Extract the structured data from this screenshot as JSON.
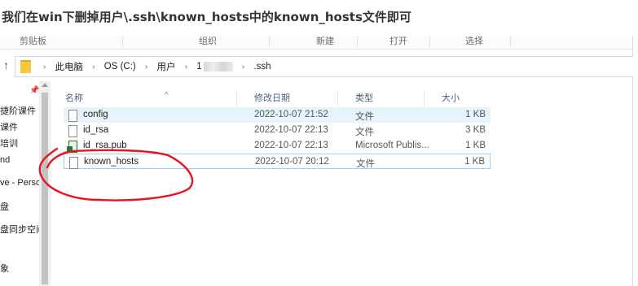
{
  "heading": "我们在win下删掉用户\\.ssh\\known_hosts中的known_hosts文件即可",
  "ribbon": {
    "groups": [
      "剪贴板",
      "组织",
      "新建",
      "打开",
      "选择"
    ]
  },
  "address": {
    "crumbs": [
      "此电脑",
      "OS (C:)",
      "用户",
      "1",
      ".ssh"
    ]
  },
  "nav_pane": {
    "items": [
      "捷阶课件",
      "课件",
      "培训",
      "nd",
      "ve - Perso",
      "盘",
      "盘同步空间",
      "象"
    ]
  },
  "columns": {
    "name": "名称",
    "date": "修改日期",
    "type": "类型",
    "size": "大小"
  },
  "files": [
    {
      "name": "config",
      "date": "2022-10-07 21:52",
      "type": "文件",
      "size": "1 KB"
    },
    {
      "name": "id_rsa",
      "date": "2022-10-07 22:13",
      "type": "文件",
      "size": "3 KB"
    },
    {
      "name": "id_rsa.pub",
      "date": "2022-10-07 22:13",
      "type": "Microsoft Publis...",
      "size": "1 KB"
    },
    {
      "name": "known_hosts",
      "date": "2022-10-07 20:12",
      "type": "文件",
      "size": "1 KB"
    }
  ],
  "colors": {
    "highlight_row": "#e5f3fb",
    "selected_border": "#99d1f5",
    "annotation": "#e8141e"
  }
}
